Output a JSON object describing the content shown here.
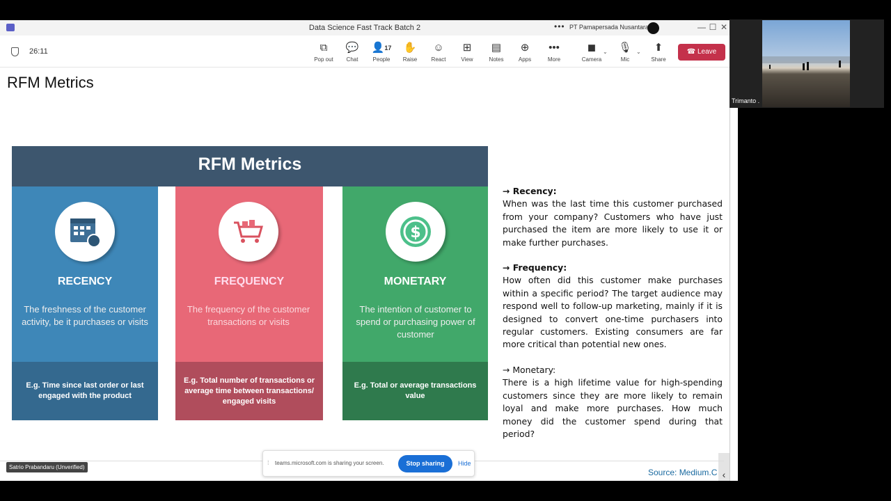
{
  "window": {
    "title": "Data Science Fast Track Batch 2",
    "org": "PT Pamapersada Nusantara",
    "more_glyph": "•••",
    "minimize_glyph": "—",
    "maximize_glyph": "☐",
    "close_glyph": "✕"
  },
  "meeting": {
    "timer": "26:11",
    "people_count": "17",
    "tools": [
      {
        "label": "Pop out",
        "icon": "popout-icon",
        "glyph": "⧉"
      },
      {
        "label": "Chat",
        "icon": "chat-icon",
        "glyph": "💬"
      },
      {
        "label": "People",
        "icon": "people-icon",
        "glyph": "👤"
      },
      {
        "label": "Raise",
        "icon": "raise-hand-icon",
        "glyph": "✋"
      },
      {
        "label": "React",
        "icon": "react-icon",
        "glyph": "☺"
      },
      {
        "label": "View",
        "icon": "view-icon",
        "glyph": "⊞"
      },
      {
        "label": "Notes",
        "icon": "notes-icon",
        "glyph": "▤"
      },
      {
        "label": "Apps",
        "icon": "apps-icon",
        "glyph": "⊕"
      },
      {
        "label": "More",
        "icon": "more-icon",
        "glyph": "•••"
      },
      {
        "label": "Camera",
        "icon": "camera-off-icon",
        "glyph": "◼"
      },
      {
        "label": "Mic",
        "icon": "mic-off-icon",
        "glyph": "🎙"
      },
      {
        "label": "Share",
        "icon": "share-icon",
        "glyph": "⬆"
      }
    ],
    "leave_label": "Leave",
    "leave_glyph": "☎"
  },
  "slide": {
    "title": "RFM Metrics",
    "infographic": {
      "header": "RFM Metrics",
      "columns": [
        {
          "title": "RECENCY",
          "desc": "The freshness of the customer activity, be it purchases or visits",
          "example": "E.g. Time since last order or last engaged with the product",
          "top_color": "#3e87b8",
          "bottom_color": "#34698f",
          "icon": "calendar-icon"
        },
        {
          "title": "FREQUENCY",
          "desc": "The frequency of the customer transactions or visits",
          "example": "E.g. Total number of transactions or average time between transactions/ engaged visits",
          "top_color": "#e86877",
          "bottom_color": "#b04d5c",
          "icon": "shopping-cart-icon"
        },
        {
          "title": "MONETARY",
          "desc": "The intention of customer to spend or purchasing power of customer",
          "example": "E.g. Total or average transactions value",
          "top_color": "#41a86a",
          "bottom_color": "#2f7a4d",
          "icon": "dollar-coin-icon"
        }
      ]
    },
    "notes": [
      {
        "heading": "→ Recency:",
        "body": "When was the last time this customer purchased from your company? Customers who have just purchased the item are more likely to use it or make further purchases."
      },
      {
        "heading": "→ Frequency:",
        "body": "How often did this customer make purchases within a specific period? The target audience may respond well to follow-up marketing, mainly if it is designed to convert one-time purchasers into regular customers. Existing consumers are far more critical than potential new ones."
      },
      {
        "heading": "→ Monetary:",
        "body": "There is a high lifetime value for high-spending customers since they are more likely to remain loyal and make more purchases. How much money did the customer spend during that period?"
      }
    ],
    "source": "Source: Medium.C",
    "side_panel_glyph": "‹"
  },
  "presenter_name": "Satrio Prabandaru (Unverified)",
  "share_bar": {
    "grip_glyph": "⁞",
    "message": "teams.microsoft.com is sharing your screen.",
    "stop_label": "Stop sharing",
    "hide_label": "Hide"
  },
  "video": {
    "participant_name": "Trimanto ."
  }
}
